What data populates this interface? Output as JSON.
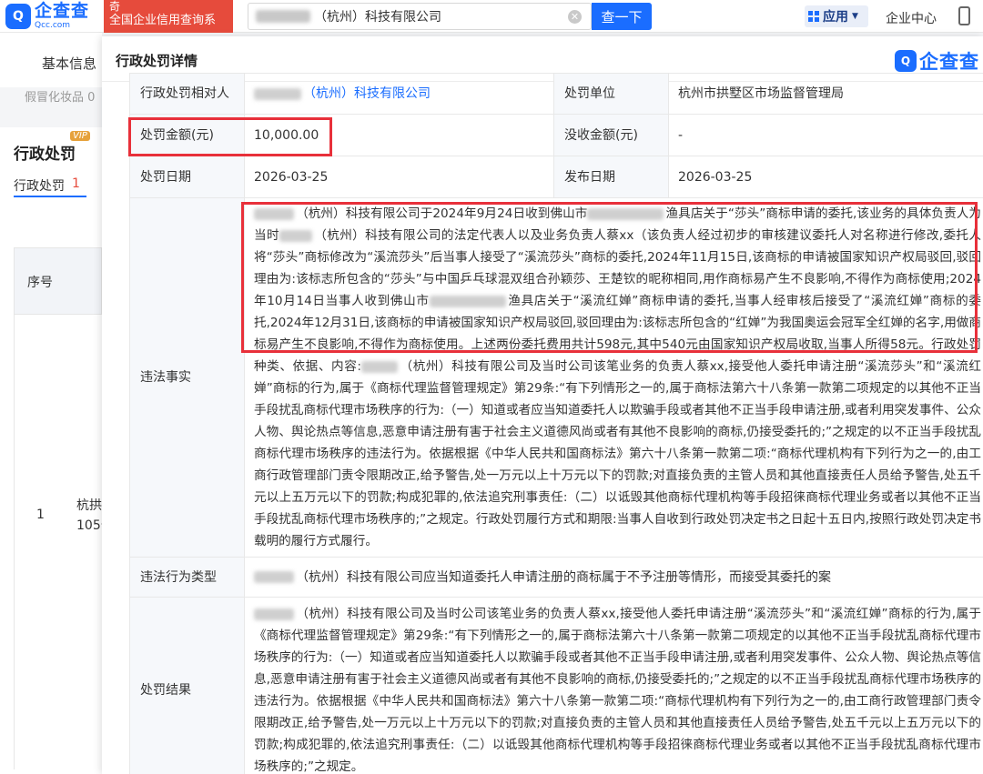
{
  "topbar": {
    "logo_mark": "Q",
    "logo_cn": "企查查",
    "logo_en": "Qcc.com",
    "badge_top": "奇",
    "badge_text": "全国企业信用查询系",
    "search_value": "（杭州）科技有限公司",
    "search_button": "查一下",
    "apps_label": "应用",
    "enterprise_center": "企业中心"
  },
  "background": {
    "nav_label": "基本信息",
    "filter_label": "假冒化妆品 0",
    "section_title": "行政处罚",
    "vip_badge": "VIP",
    "tab_label": "行政处罚",
    "tab_count": "1",
    "table_header": "序号",
    "row_number": "1",
    "row_text_1": "杭拱",
    "row_text_2": "105号"
  },
  "modal": {
    "title": "行政处罚详情",
    "logo_mark": "Q",
    "logo_text": "企查查",
    "rows": {
      "party_label": "行政处罚相对人",
      "party_value": "（杭州）科技有限公司",
      "unit_label": "处罚单位",
      "unit_value": "杭州市拱墅区市场监督管理局",
      "amount_label": "处罚金额(元)",
      "amount_value": "10,000.00",
      "confiscate_label": "没收金额(元)",
      "confiscate_value": "-",
      "date_label": "处罚日期",
      "date_value": "2026-03-25",
      "publish_label": "发布日期",
      "publish_value": "2026-03-25",
      "facts_label": "违法事实",
      "facts_p1": "（杭州）科技有限公司于2024年9月24日收到佛山市",
      "facts_p2": "渔具店关于“莎头”商标申请的委托,该业务的具体负责人为当时",
      "facts_p3": "（杭州）科技有限公司的法定代表人以及业务负责人蔡xx（该负责人经过初步的审核建议委托人对名称进行修改,委托人将“莎头”商标修改为“溪流莎头”后当事人接受了“溪流莎头”商标的委托,2024年11月15日,该商标的申请被国家知识产权局驳回,驳回理由为:该标志所包含的“莎头”与中国乒乓球混双组合孙颖莎、王楚钦的昵称相同,用作商标易产生不良影响,不得作为商标使用;2024年10月14日当事人收到佛山市",
      "facts_p4": "渔具店关于“溪流红婵”商标申请的委托,当事人经审核后接受了“溪流红婵”商标的委托,2024年12月31日,该商标的申请被国家知识产权局驳回,驳回理由为:该标志所包含的“红婵”为我国奥运会冠军全红婵的名字,用做商标易产生不良影响,不得作为商标使用。上述两份委托费用共计598元,其中540元由国家知识产权局收取,当事人所得58元。行政处罚种类、依据、内容:",
      "facts_p5": "（杭州）科技有限公司及当时公司该笔业务的负责人蔡xx,接受他人委托申请注册“溪流莎头”和“溪流红婵”商标的行为,属于《商标代理监督管理规定》第29条:“有下列情形之一的,属于商标法第六十八条第一款第二项规定的以其他不正当手段扰乱商标代理市场秩序的行为:（一）知道或者应当知道委托人以欺骗手段或者其他不正当手段申请注册,或者利用突发事件、公众人物、舆论热点等信息,恶意申请注册有害于社会主义道德风尚或者有其他不良影响的商标,仍接受委托的;”之规定的以不正当手段扰乱商标代理市场秩序的违法行为。依据根据《中华人民共和国商标法》第六十八条第一款第二项:“商标代理机构有下列行为之一的,由工商行政管理部门责令限期改正,给予警告,处一万元以上十万元以下的罚款;对直接负责的主管人员和其他直接责任人员给予警告,处五千元以上五万元以下的罚款;构成犯罪的,依法追究刑事责任:（二）以诋毁其他商标代理机构等手段招徕商标代理业务或者以其他不正当手段扰乱商标代理市场秩序的;”之规定。行政处罚履行方式和期限:当事人自收到行政处罚决定书之日起十五日内,按照行政处罚决定书载明的履行方式履行。",
      "type_label": "违法行为类型",
      "type_value": "（杭州）科技有限公司应当知道委托人申请注册的商标属于不予注册等情形，而接受其委托的案",
      "result_label": "处罚结果",
      "result_value": "（杭州）科技有限公司及当时公司该笔业务的负责人蔡xx,接受他人委托申请注册“溪流莎头”和“溪流红婵”商标的行为,属于《商标代理监督管理规定》第29条:“有下列情形之一的,属于商标法第六十八条第一款第二项规定的以其他不正当手段扰乱商标代理市场秩序的行为:（一）知道或者应当知道委托人以欺骗手段或者其他不正当手段申请注册,或者利用突发事件、公众人物、舆论热点等信息,恶意申请注册有害于社会主义道德风尚或者有其他不良影响的商标,仍接受委托的;”之规定的以不正当手段扰乱商标代理市场秩序的违法行为。依据根据《中华人民共和国商标法》第六十八条第一款第二项:“商标代理机构有下列行为之一的,由工商行政管理部门责令限期改正,给予警告,处一万元以上十万元以下的罚款;对直接负责的主管人员和其他直接责任人员给予警告,处五千元以上五万元以下的罚款;构成犯罪的,依法追究刑事责任:（二）以诋毁其他商标代理机构等手段招徕商标代理业务或者以其他不正当手段扰乱商标代理市场秩序的;”之规定。"
    }
  },
  "colors": {
    "brand_blue": "#1a6dff",
    "highlight_red": "#e8303a",
    "badge_red": "#e64b3c"
  }
}
